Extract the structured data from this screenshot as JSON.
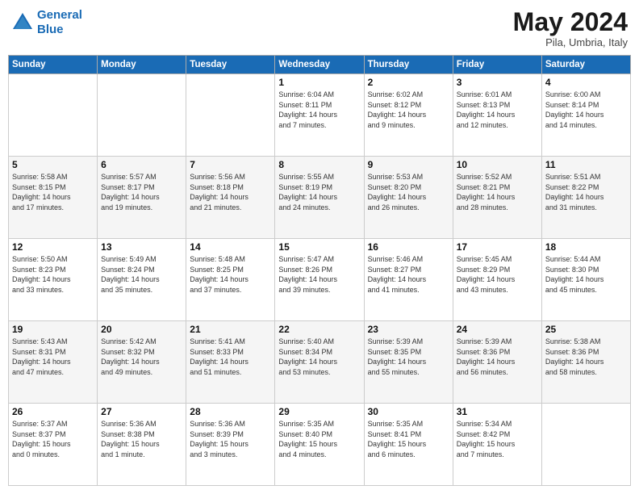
{
  "header": {
    "logo_line1": "General",
    "logo_line2": "Blue",
    "title": "May 2024",
    "subtitle": "Pila, Umbria, Italy"
  },
  "weekdays": [
    "Sunday",
    "Monday",
    "Tuesday",
    "Wednesday",
    "Thursday",
    "Friday",
    "Saturday"
  ],
  "weeks": [
    [
      {
        "day": "",
        "info": ""
      },
      {
        "day": "",
        "info": ""
      },
      {
        "day": "",
        "info": ""
      },
      {
        "day": "1",
        "info": "Sunrise: 6:04 AM\nSunset: 8:11 PM\nDaylight: 14 hours\nand 7 minutes."
      },
      {
        "day": "2",
        "info": "Sunrise: 6:02 AM\nSunset: 8:12 PM\nDaylight: 14 hours\nand 9 minutes."
      },
      {
        "day": "3",
        "info": "Sunrise: 6:01 AM\nSunset: 8:13 PM\nDaylight: 14 hours\nand 12 minutes."
      },
      {
        "day": "4",
        "info": "Sunrise: 6:00 AM\nSunset: 8:14 PM\nDaylight: 14 hours\nand 14 minutes."
      }
    ],
    [
      {
        "day": "5",
        "info": "Sunrise: 5:58 AM\nSunset: 8:15 PM\nDaylight: 14 hours\nand 17 minutes."
      },
      {
        "day": "6",
        "info": "Sunrise: 5:57 AM\nSunset: 8:17 PM\nDaylight: 14 hours\nand 19 minutes."
      },
      {
        "day": "7",
        "info": "Sunrise: 5:56 AM\nSunset: 8:18 PM\nDaylight: 14 hours\nand 21 minutes."
      },
      {
        "day": "8",
        "info": "Sunrise: 5:55 AM\nSunset: 8:19 PM\nDaylight: 14 hours\nand 24 minutes."
      },
      {
        "day": "9",
        "info": "Sunrise: 5:53 AM\nSunset: 8:20 PM\nDaylight: 14 hours\nand 26 minutes."
      },
      {
        "day": "10",
        "info": "Sunrise: 5:52 AM\nSunset: 8:21 PM\nDaylight: 14 hours\nand 28 minutes."
      },
      {
        "day": "11",
        "info": "Sunrise: 5:51 AM\nSunset: 8:22 PM\nDaylight: 14 hours\nand 31 minutes."
      }
    ],
    [
      {
        "day": "12",
        "info": "Sunrise: 5:50 AM\nSunset: 8:23 PM\nDaylight: 14 hours\nand 33 minutes."
      },
      {
        "day": "13",
        "info": "Sunrise: 5:49 AM\nSunset: 8:24 PM\nDaylight: 14 hours\nand 35 minutes."
      },
      {
        "day": "14",
        "info": "Sunrise: 5:48 AM\nSunset: 8:25 PM\nDaylight: 14 hours\nand 37 minutes."
      },
      {
        "day": "15",
        "info": "Sunrise: 5:47 AM\nSunset: 8:26 PM\nDaylight: 14 hours\nand 39 minutes."
      },
      {
        "day": "16",
        "info": "Sunrise: 5:46 AM\nSunset: 8:27 PM\nDaylight: 14 hours\nand 41 minutes."
      },
      {
        "day": "17",
        "info": "Sunrise: 5:45 AM\nSunset: 8:29 PM\nDaylight: 14 hours\nand 43 minutes."
      },
      {
        "day": "18",
        "info": "Sunrise: 5:44 AM\nSunset: 8:30 PM\nDaylight: 14 hours\nand 45 minutes."
      }
    ],
    [
      {
        "day": "19",
        "info": "Sunrise: 5:43 AM\nSunset: 8:31 PM\nDaylight: 14 hours\nand 47 minutes."
      },
      {
        "day": "20",
        "info": "Sunrise: 5:42 AM\nSunset: 8:32 PM\nDaylight: 14 hours\nand 49 minutes."
      },
      {
        "day": "21",
        "info": "Sunrise: 5:41 AM\nSunset: 8:33 PM\nDaylight: 14 hours\nand 51 minutes."
      },
      {
        "day": "22",
        "info": "Sunrise: 5:40 AM\nSunset: 8:34 PM\nDaylight: 14 hours\nand 53 minutes."
      },
      {
        "day": "23",
        "info": "Sunrise: 5:39 AM\nSunset: 8:35 PM\nDaylight: 14 hours\nand 55 minutes."
      },
      {
        "day": "24",
        "info": "Sunrise: 5:39 AM\nSunset: 8:36 PM\nDaylight: 14 hours\nand 56 minutes."
      },
      {
        "day": "25",
        "info": "Sunrise: 5:38 AM\nSunset: 8:36 PM\nDaylight: 14 hours\nand 58 minutes."
      }
    ],
    [
      {
        "day": "26",
        "info": "Sunrise: 5:37 AM\nSunset: 8:37 PM\nDaylight: 15 hours\nand 0 minutes."
      },
      {
        "day": "27",
        "info": "Sunrise: 5:36 AM\nSunset: 8:38 PM\nDaylight: 15 hours\nand 1 minute."
      },
      {
        "day": "28",
        "info": "Sunrise: 5:36 AM\nSunset: 8:39 PM\nDaylight: 15 hours\nand 3 minutes."
      },
      {
        "day": "29",
        "info": "Sunrise: 5:35 AM\nSunset: 8:40 PM\nDaylight: 15 hours\nand 4 minutes."
      },
      {
        "day": "30",
        "info": "Sunrise: 5:35 AM\nSunset: 8:41 PM\nDaylight: 15 hours\nand 6 minutes."
      },
      {
        "day": "31",
        "info": "Sunrise: 5:34 AM\nSunset: 8:42 PM\nDaylight: 15 hours\nand 7 minutes."
      },
      {
        "day": "",
        "info": ""
      }
    ]
  ]
}
